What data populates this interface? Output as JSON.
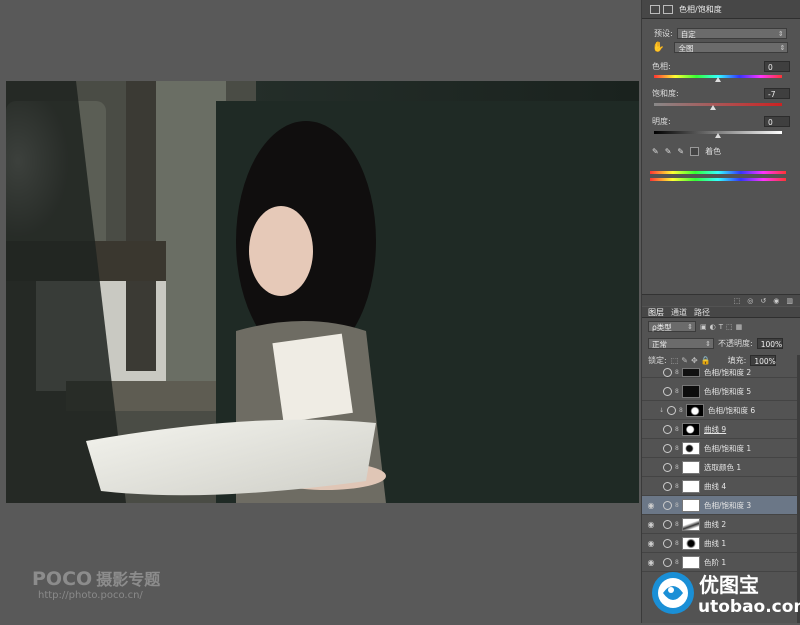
{
  "panel": {
    "title": "色相/饱和度",
    "preset_label": "预设:",
    "preset_value": "自定",
    "channel_value": "全图",
    "hue_label": "色相:",
    "hue_value": "0",
    "saturation_label": "饱和度:",
    "saturation_value": "-7",
    "lightness_label": "明度:",
    "lightness_value": "0",
    "colorize_label": "着色"
  },
  "layers_panel": {
    "tabs": [
      "图层",
      "通道",
      "路径"
    ],
    "filter_value": "ρ类型",
    "blend_mode": "正常",
    "opacity_label": "不透明度:",
    "opacity_value": "100%",
    "lock_label": "锁定:",
    "fill_label": "填充:",
    "fill_value": "100%",
    "layers": [
      {
        "name": "色相/饱和度 2"
      },
      {
        "name": "色相/饱和度 5"
      },
      {
        "name": "色相/饱和度 6"
      },
      {
        "name": "曲线 9"
      },
      {
        "name": "色相/饱和度 1"
      },
      {
        "name": "选取颜色 1"
      },
      {
        "name": "曲线 4"
      },
      {
        "name": "色相/饱和度 3"
      },
      {
        "name": "曲线 2"
      },
      {
        "name": "曲线 1"
      },
      {
        "name": "色阶 1"
      }
    ]
  },
  "watermark": {
    "brand": "POCO",
    "brand_cn": "摄影专题",
    "url": "http://photo.poco.cn/"
  },
  "logo": {
    "cn": "优图宝",
    "url": "utobao.com"
  }
}
